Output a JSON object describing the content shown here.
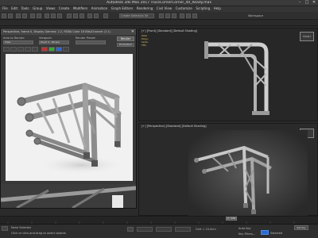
{
  "window": {
    "title": "Autodesk 3ds Max 2017   TrussCornerCorner_40_Ready.max"
  },
  "menu": [
    "File",
    "Edit",
    "Tools",
    "Group",
    "Views",
    "Create",
    "Modifiers",
    "Animation",
    "Graph Editors",
    "Rendering",
    "Civil View",
    "Customize",
    "Scripting",
    "Help"
  ],
  "toolbar": {
    "selection_set": "Create Selection Se",
    "workspace_label": "Workspace"
  },
  "render_window": {
    "title": "Perspective, frame 0, Display Gamma: 2.2, RGBA Color 16 Bits/Channel (1:1)",
    "area_label": "Area to Render:",
    "area_value": "View",
    "viewport_label": "Viewport:",
    "viewport_value": "Quad 4 - Perspe",
    "preset_label": "Render Preset:",
    "preset_value": "",
    "render_button": "Render",
    "production_value": "Production"
  },
  "viewports": {
    "top_label": "[+] [Front] [Standard] [Default Shading]",
    "top_stats": [
      "Total",
      "Polys:",
      "Verts:",
      "FPS:"
    ],
    "persp_label": "[+] [Perspective] [Standard] [Default Shading]",
    "viewcube_top": "FRONT",
    "viewcube_persp": ""
  },
  "timeline": {
    "frame_indicator": "0 / 100"
  },
  "status": {
    "selected": "None Selected",
    "prompt": "Click or click-and-drag to select objects",
    "grid": "Grid = 10.0cm",
    "auto_key": "Auto Key",
    "selected_label": "Selected",
    "set_key": "Set Key",
    "key_filters": "Key Filters..."
  },
  "colors": {
    "ui_bg": "#2b2b2b",
    "viewport_bg": "#272727",
    "accent_blue": "#2a6bd1"
  }
}
